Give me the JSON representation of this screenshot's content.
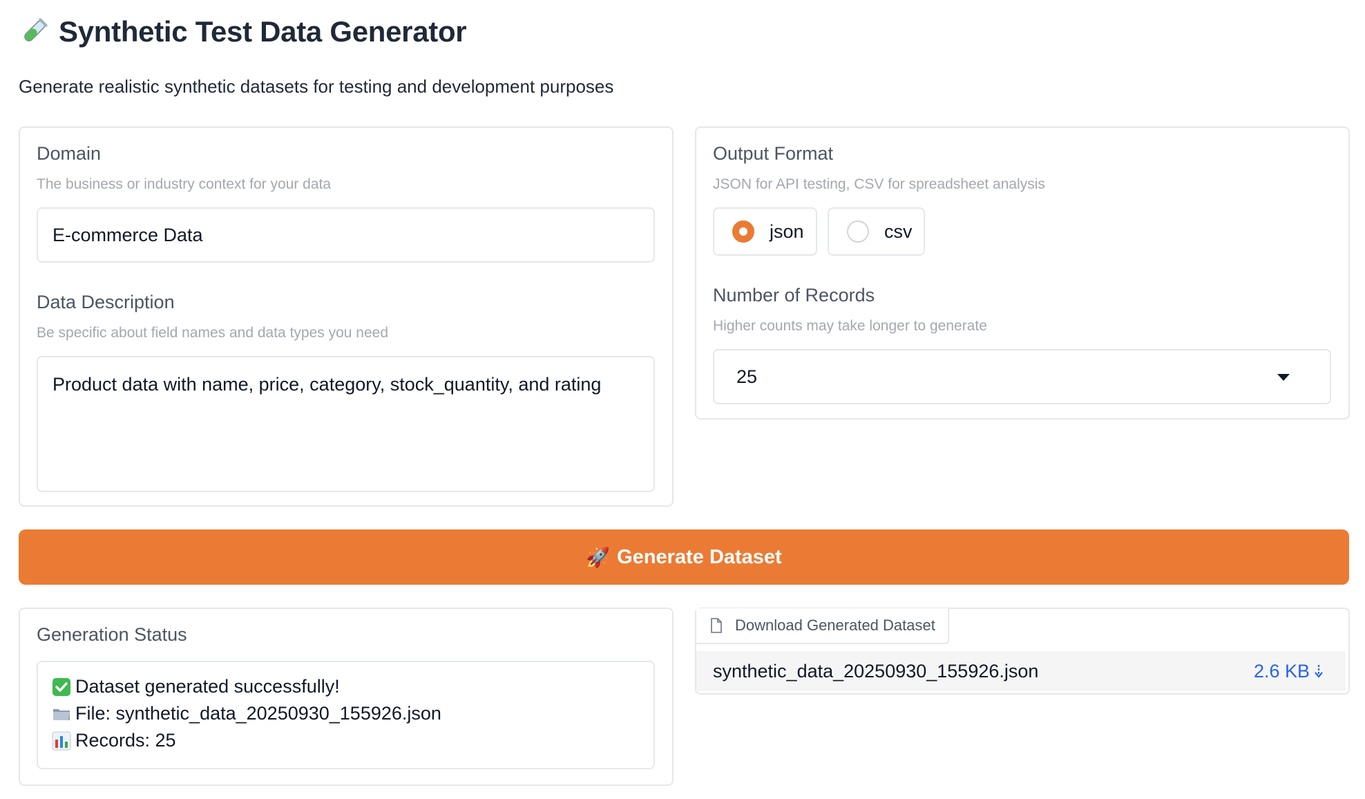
{
  "header": {
    "title_icon": "test-tube-icon",
    "title": "Synthetic Test Data Generator",
    "subtitle": "Generate realistic synthetic datasets for testing and development purposes"
  },
  "domain": {
    "label": "Domain",
    "info": "The business or industry context for your data",
    "value": "E-commerce Data"
  },
  "description": {
    "label": "Data Description",
    "info": "Be specific about field names and data types you need",
    "value": "Product data with name, price, category, stock_quantity, and rating"
  },
  "output_format": {
    "label": "Output Format",
    "info": "JSON for API testing, CSV for spreadsheet analysis",
    "options": [
      {
        "label": "json",
        "selected": true
      },
      {
        "label": "csv",
        "selected": false
      }
    ]
  },
  "records": {
    "label": "Number of Records",
    "info": "Higher counts may take longer to generate",
    "value": "25"
  },
  "generate_button": {
    "icon": "rocket-icon",
    "label": "Generate Dataset"
  },
  "status": {
    "label": "Generation Status",
    "lines": [
      {
        "icon": "check-icon",
        "text": "Dataset generated successfully!"
      },
      {
        "icon": "folder-icon",
        "text": "File: synthetic_data_20250930_155926.json"
      },
      {
        "icon": "bar-chart-icon",
        "text": "Records: 25"
      }
    ]
  },
  "download": {
    "tab_icon": "file-icon",
    "tab_label": "Download Generated Dataset",
    "file_name": "synthetic_data_20250930_155926.json",
    "file_size": "2.6 KB",
    "download_icon": "download-arrow-icon"
  },
  "colors": {
    "accent": "#eb7b34",
    "link": "#2563eb",
    "border": "#e5e7eb"
  }
}
